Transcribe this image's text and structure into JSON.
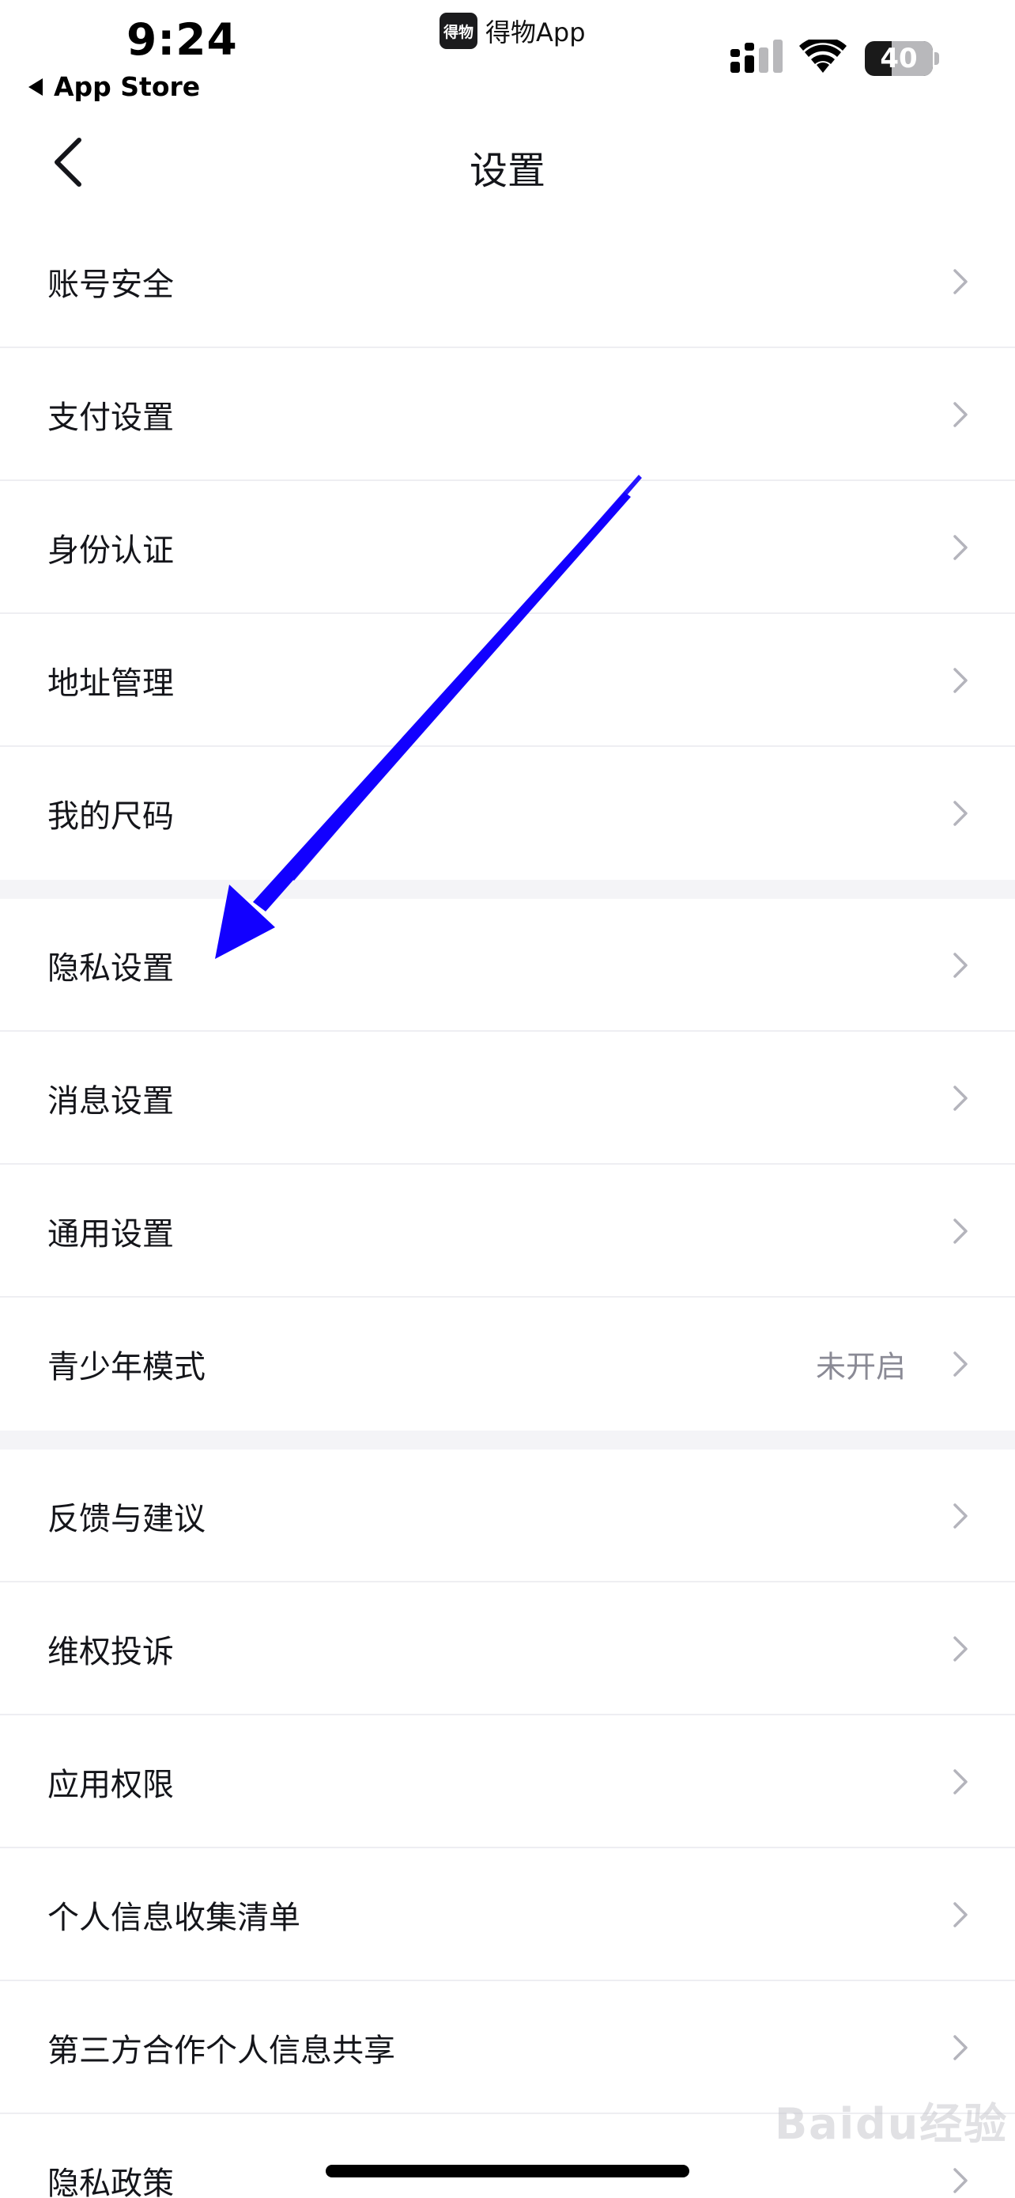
{
  "status_bar": {
    "time": "9:24",
    "back_app": "App Store",
    "app_logo_text": "得物",
    "app_name": "得物App",
    "battery_level": "40",
    "battery_fraction": 0.4
  },
  "nav": {
    "title": "设置",
    "back_icon": "chevron-left-icon"
  },
  "groups": [
    {
      "items": [
        {
          "label": "账号安全",
          "value": ""
        },
        {
          "label": "支付设置",
          "value": ""
        },
        {
          "label": "身份认证",
          "value": ""
        },
        {
          "label": "地址管理",
          "value": ""
        },
        {
          "label": "我的尺码",
          "value": ""
        }
      ]
    },
    {
      "items": [
        {
          "label": "隐私设置",
          "value": ""
        },
        {
          "label": "消息设置",
          "value": ""
        },
        {
          "label": "通用设置",
          "value": ""
        },
        {
          "label": "青少年模式",
          "value": "未开启"
        }
      ]
    },
    {
      "items": [
        {
          "label": "反馈与建议",
          "value": ""
        },
        {
          "label": "维权投诉",
          "value": ""
        },
        {
          "label": "应用权限",
          "value": ""
        },
        {
          "label": "个人信息收集清单",
          "value": ""
        },
        {
          "label": "第三方合作个人信息共享",
          "value": ""
        },
        {
          "label": "隐私政策",
          "value": ""
        }
      ]
    }
  ],
  "annotation": {
    "arrow_color": "#1200ff"
  },
  "watermark": "Baidu经验",
  "colors": {
    "text": "#14151a",
    "secondary": "#8a8a95",
    "chevron": "#b4b4bc",
    "divider": "#eeeef2",
    "group_gap": "#f4f4f7"
  }
}
